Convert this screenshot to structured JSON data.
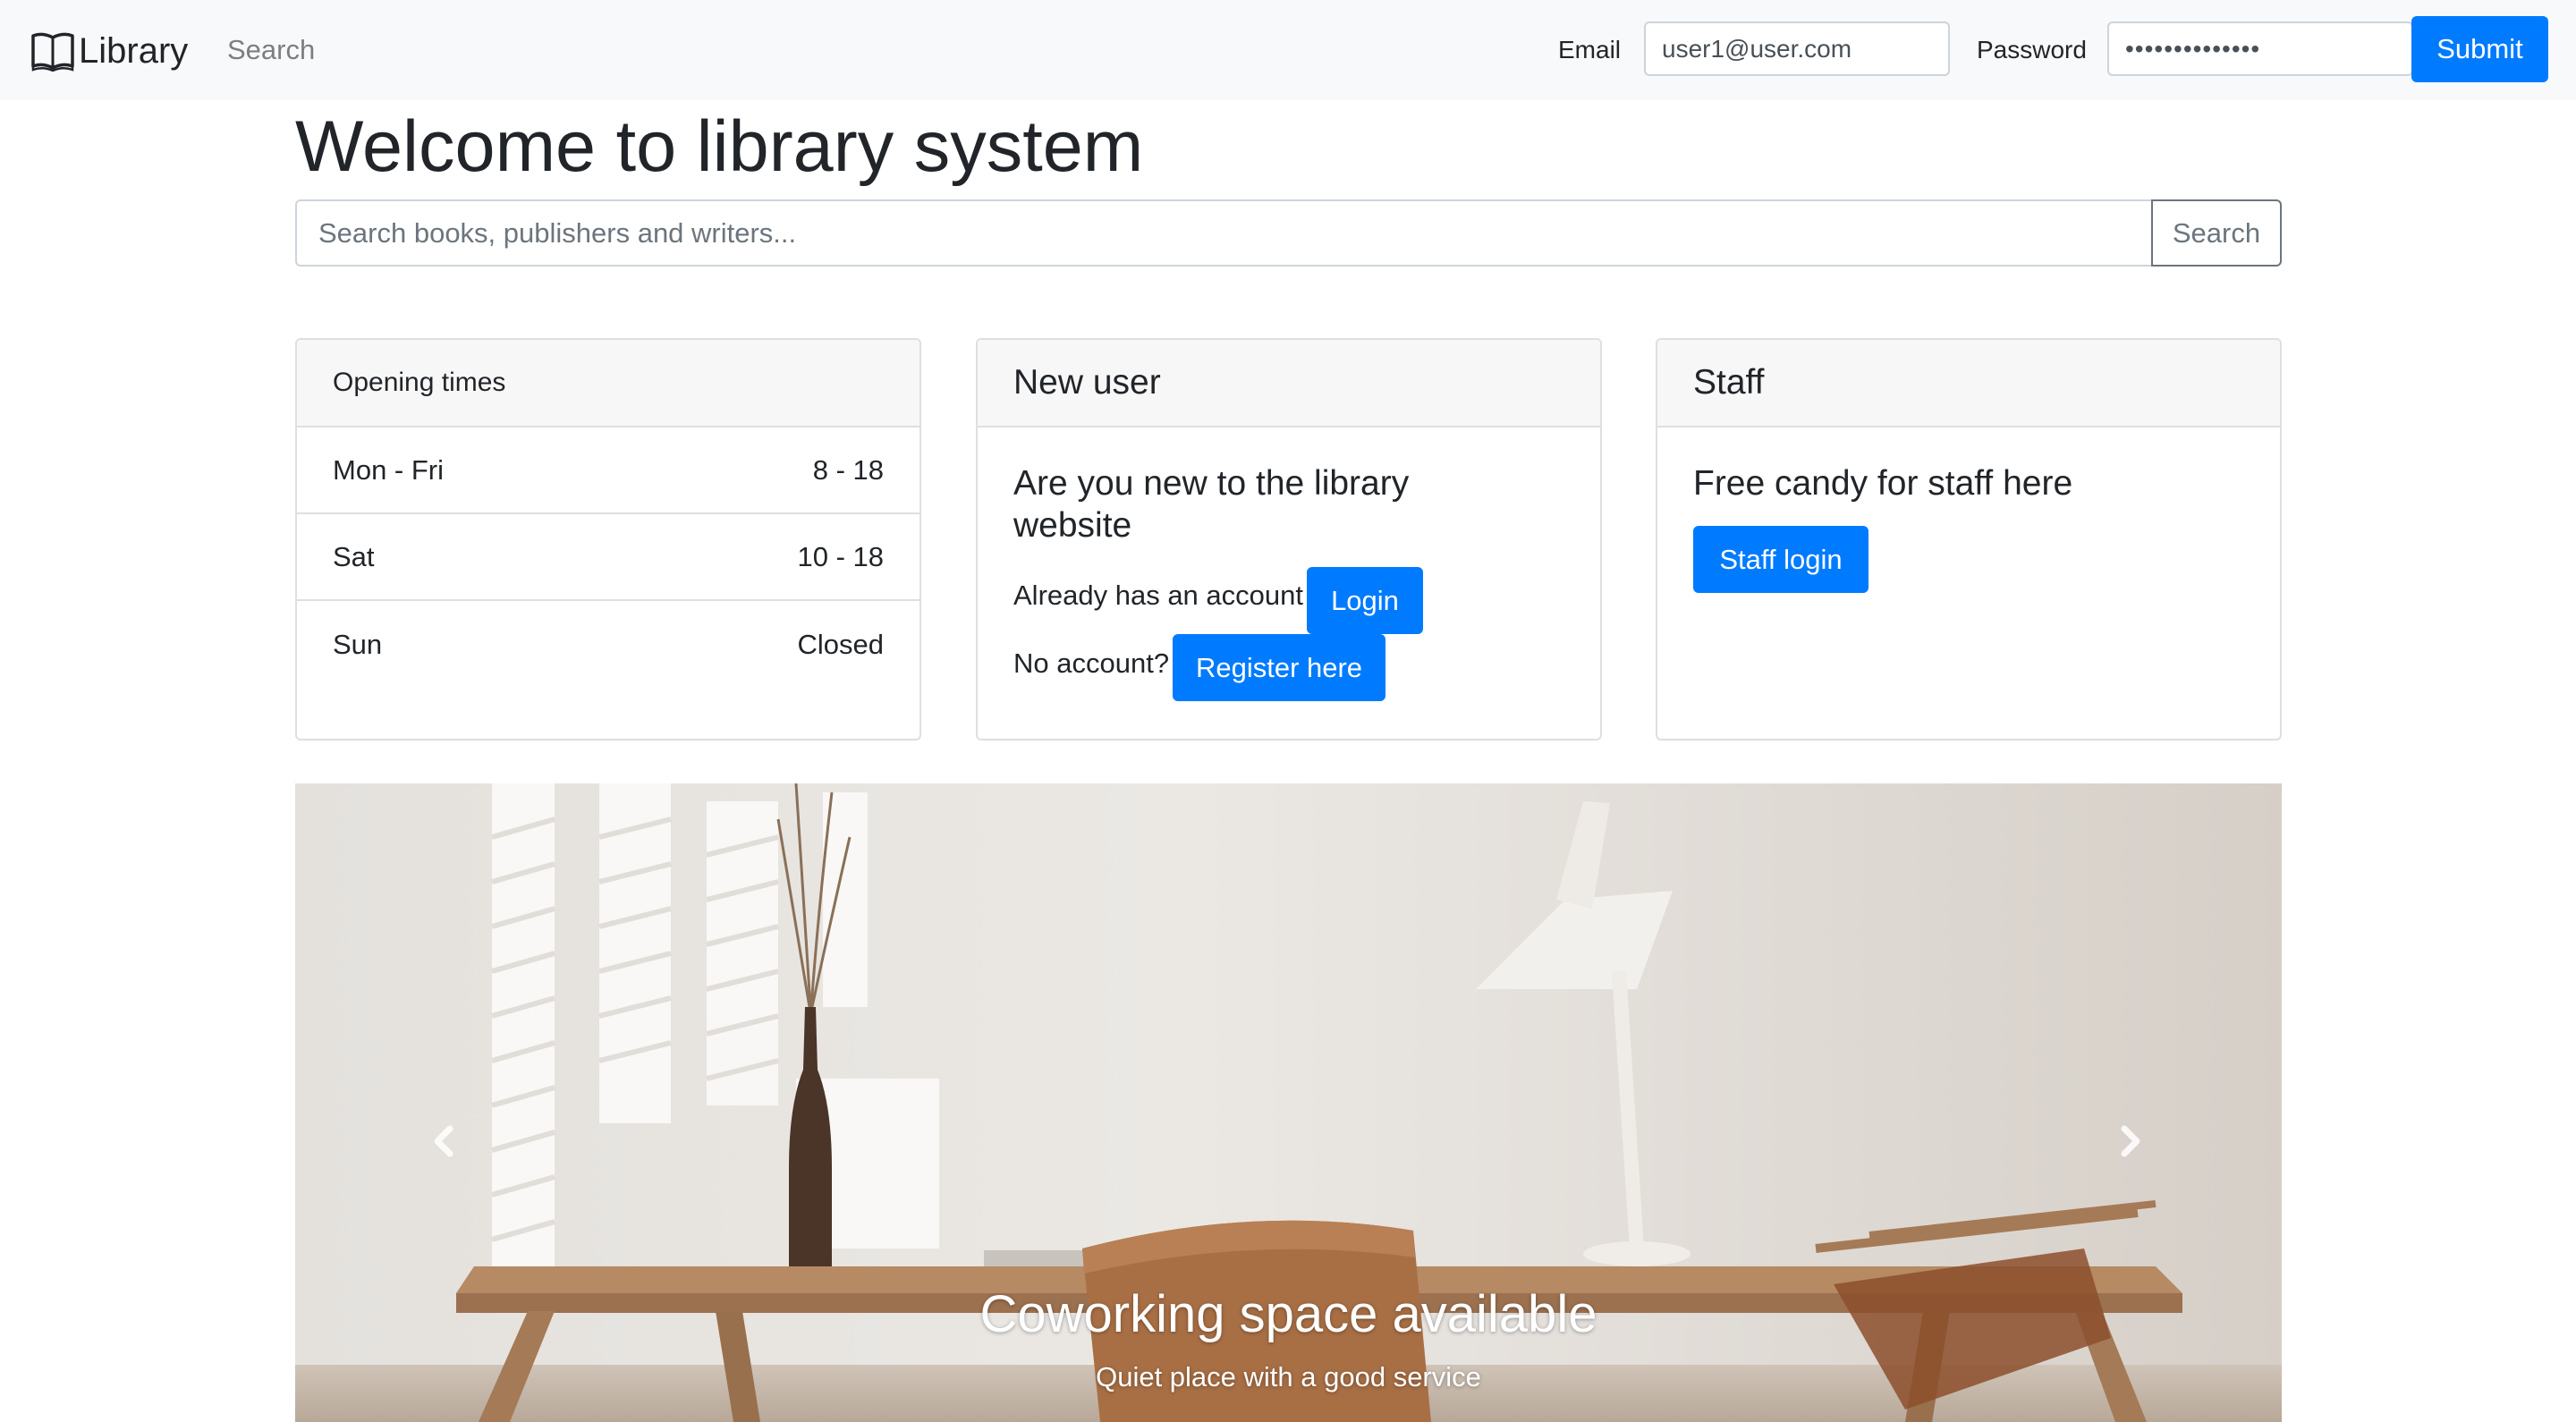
{
  "navbar": {
    "brand": "Library",
    "search_link": "Search",
    "email_label": "Email",
    "email_value": "user1@user.com",
    "password_label": "Password",
    "password_value": "••••••••••••••",
    "submit_label": "Submit",
    "brand_icon": "book-icon"
  },
  "header": {
    "title": "Welcome to library system",
    "search_placeholder": "Search books, publishers and writers...",
    "search_button": "Search"
  },
  "opening_times": {
    "title": "Opening times",
    "rows": [
      {
        "day": "Mon - Fri",
        "hours": "8 - 18"
      },
      {
        "day": "Sat",
        "hours": "10 - 18"
      },
      {
        "day": "Sun",
        "hours": "Closed"
      }
    ]
  },
  "new_user": {
    "header": "New user",
    "title": "Are you new to the library website",
    "login_text": "Already has an account",
    "login_button": "Login",
    "register_text": "No account?",
    "register_button": "Register here"
  },
  "staff": {
    "header": "Staff",
    "title": "Free candy for staff here",
    "login_button": "Staff login"
  },
  "carousel": {
    "caption_title": "Coworking space available",
    "caption_text": "Quiet place with a good service",
    "prev_icon": "chevron-left-icon",
    "next_icon": "chevron-right-icon"
  },
  "colors": {
    "primary": "#007bff",
    "navbar_bg": "#f8f9fa",
    "card_header_bg": "#f7f7f7",
    "border": "#dfdfdf"
  }
}
